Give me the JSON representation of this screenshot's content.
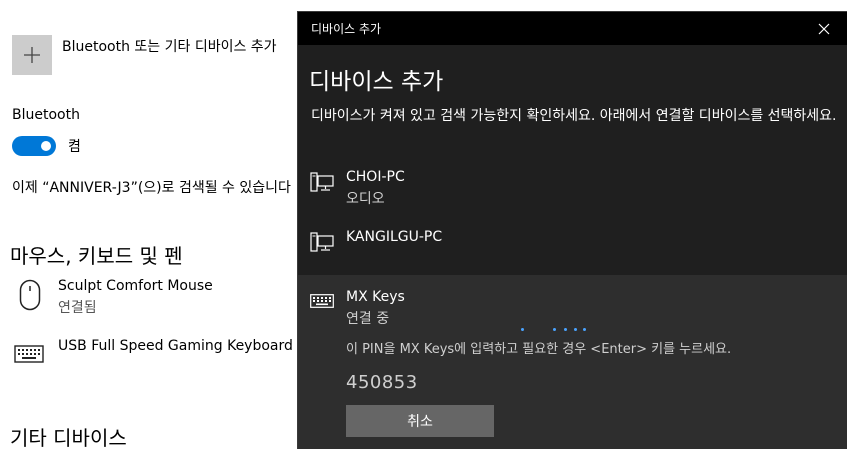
{
  "settings": {
    "add_device_label": "Bluetooth 또는 기타 디바이스 추가",
    "bluetooth_heading": "Bluetooth",
    "bluetooth_toggle_state": "켬",
    "discoverable_text": "이제 “ANNIVER-J3”(으)로 검색될 수 있습니다",
    "mouse_section_title": "마우스, 키보드 및 펜",
    "devices": [
      {
        "name": "Sculpt Comfort Mouse",
        "status": "연결됨",
        "icon": "mouse-icon"
      },
      {
        "name": "USB Full Speed Gaming Keyboard",
        "status": "",
        "icon": "keyboard-icon"
      }
    ],
    "other_section_title": "기타 디바이스"
  },
  "dialog": {
    "window_title": "디바이스 추가",
    "heading": "디바이스 추가",
    "instruction": "디바이스가 켜져 있고 검색 가능한지 확인하세요. 아래에서 연결할 디바이스를 선택하세요.",
    "items": [
      {
        "name": "CHOI-PC",
        "subtitle": "오디오",
        "icon": "computer-icon"
      },
      {
        "name": "KANGILGU-PC",
        "subtitle": "",
        "icon": "computer-icon"
      },
      {
        "name": "MX Keys",
        "subtitle": "연결 중",
        "icon": "keyboard-icon"
      }
    ],
    "pin_instruction": "이 PIN을 MX Keys에 입력하고 필요한 경우 <Enter> 키를 누르세요.",
    "pin": "450853",
    "cancel_label": "취소",
    "accent_color": "#4aa3ff"
  }
}
